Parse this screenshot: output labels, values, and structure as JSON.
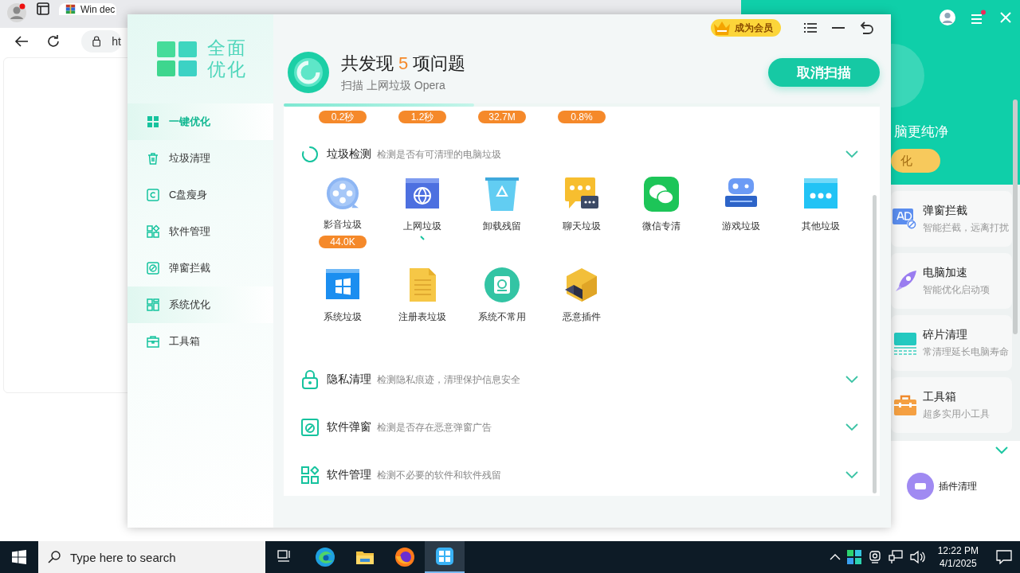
{
  "browser": {
    "tab_title": "Win dec",
    "address": "ht"
  },
  "main_app": {
    "logo": {
      "line1": "全面",
      "line2": "优化"
    },
    "nav": [
      {
        "label": "一键优化",
        "selected": true,
        "highlighted": true
      },
      {
        "label": "垃圾清理",
        "selected": false,
        "highlighted": false
      },
      {
        "label": "C盘瘦身",
        "selected": false,
        "highlighted": false
      },
      {
        "label": "软件管理",
        "selected": false,
        "highlighted": false
      },
      {
        "label": "弹窗拦截",
        "selected": false,
        "highlighted": false
      },
      {
        "label": "系统优化",
        "selected": false,
        "highlighted": true
      },
      {
        "label": "工具箱",
        "selected": false,
        "highlighted": false
      }
    ],
    "vip_badge": "成为会员",
    "scan": {
      "title_prefix": "共发现",
      "count": "5",
      "title_suffix": "项问题",
      "subtitle": "扫描 上网垃圾 Opera",
      "level": 0.32
    },
    "cancel_button": "取消扫描",
    "stats": [
      "0.2秒",
      "1.2秒",
      "32.7M",
      "0.8%"
    ],
    "sections": [
      {
        "title": "垃圾检测",
        "description": "检测是否有可清理的电脑垃圾",
        "items": [
          {
            "label": "影音垃圾",
            "badge": "44.0K",
            "scanning": false
          },
          {
            "label": "上网垃圾",
            "scanning": true
          },
          {
            "label": "卸载残留",
            "scanning": false
          },
          {
            "label": "聊天垃圾",
            "scanning": false
          },
          {
            "label": "微信专清",
            "scanning": false
          },
          {
            "label": "游戏垃圾",
            "scanning": false
          },
          {
            "label": "其他垃圾",
            "scanning": false
          },
          {
            "label": "系统垃圾",
            "scanning": false
          },
          {
            "label": "注册表垃圾",
            "scanning": false
          },
          {
            "label": "系统不常用",
            "scanning": false
          },
          {
            "label": "恶意插件",
            "scanning": false
          }
        ]
      },
      {
        "title": "隐私清理",
        "description": "检测隐私痕迹，清理保护信息安全"
      },
      {
        "title": "软件弹窗",
        "description": "检测是否存在恶意弹窗广告"
      },
      {
        "title": "软件管理",
        "description": "检测不必要的软件和软件残留"
      }
    ]
  },
  "side_app": {
    "slogan": "脑更纯净",
    "button": "化",
    "cards": [
      {
        "title": "弹窗拦截",
        "subtitle": "智能拦截，远离打扰"
      },
      {
        "title": "电脑加速",
        "subtitle": "智能优化启动项"
      },
      {
        "title": "碎片清理",
        "subtitle": "常清理延长电脑寿命"
      },
      {
        "title": "工具箱",
        "subtitle": "超多实用小工具"
      }
    ],
    "plugin": "插件清理"
  },
  "taskbar": {
    "search_placeholder": "Type here to search",
    "time": "12:22 PM",
    "date": "4/1/2025",
    "apps": [
      {
        "selected": false
      },
      {
        "selected": false
      },
      {
        "selected": false
      },
      {
        "selected": true
      }
    ]
  }
}
